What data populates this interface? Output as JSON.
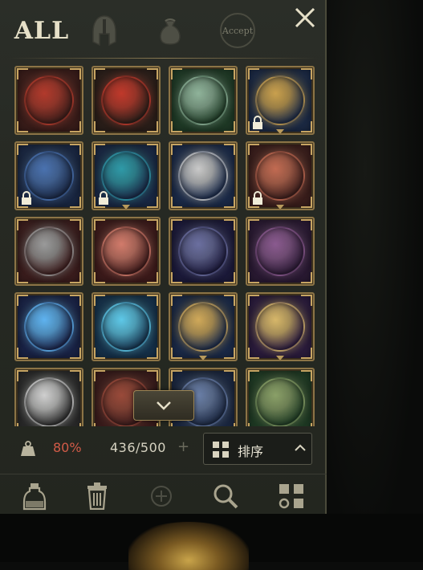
{
  "header": {
    "tab_all_label": "ALL",
    "tab_accept_label": "Accept",
    "close_glyph": "✕"
  },
  "grid": {
    "rows": [
      [
        {
          "name": "red-tome-icon",
          "bg": "#3a1d1a",
          "color": "#b23a2c",
          "locked": false,
          "notch": false
        },
        {
          "name": "lion-crest-shield-icon",
          "bg": "#2b1f1a",
          "color": "#c0392b",
          "locked": false,
          "notch": false
        },
        {
          "name": "green-mask-shield-icon",
          "bg": "#1f3a26",
          "color": "#8fb39a",
          "locked": false,
          "notch": false
        },
        {
          "name": "gold-ornate-crest-icon",
          "bg": "#1c2a45",
          "color": "#c9a04e",
          "locked": true,
          "notch": true
        }
      ],
      [
        {
          "name": "blue-winged-helm-icon",
          "bg": "#1a2742",
          "color": "#4a72b0",
          "locked": true,
          "notch": false
        },
        {
          "name": "teal-orb-crest-icon",
          "bg": "#1a2844",
          "color": "#2f9aa8",
          "locked": true,
          "notch": true
        },
        {
          "name": "yin-yang-icon",
          "bg": "#1b2a48",
          "color": "#c9c9c9",
          "locked": false,
          "notch": false
        },
        {
          "name": "crimson-horned-crest-icon",
          "bg": "#3a1e1c",
          "color": "#c26b52",
          "locked": true,
          "notch": true
        }
      ],
      [
        {
          "name": "silver-dragon-wreath-icon",
          "bg": "#3b1d1d",
          "color": "#9a9a9a",
          "locked": false,
          "notch": false
        },
        {
          "name": "red-ghost-figure-icon",
          "bg": "#3d1b1b",
          "color": "#d27b6b",
          "locked": false,
          "notch": false
        },
        {
          "name": "dark-crystal-orb-icon",
          "bg": "#1c1a3a",
          "color": "#6b6fa0",
          "locked": false,
          "notch": false
        },
        {
          "name": "purple-beast-skull-icon",
          "bg": "#2a1a33",
          "color": "#8a5a8f",
          "locked": false,
          "notch": false
        }
      ],
      [
        {
          "name": "blue-star-crystal-icon",
          "bg": "#1a2346",
          "color": "#5fb3f0",
          "locked": false,
          "notch": false
        },
        {
          "name": "blue-diamond-gem-icon",
          "bg": "#16314a",
          "color": "#5ec8e8",
          "locked": false,
          "notch": false
        },
        {
          "name": "pocket-watch-icon",
          "bg": "#1b2a48",
          "color": "#d0a95a",
          "locked": false,
          "notch": true
        },
        {
          "name": "gold-filigree-crest-icon",
          "bg": "#2b1c3d",
          "color": "#d7b76a",
          "locked": false,
          "notch": true
        }
      ],
      [
        {
          "name": "silver-blade-icon",
          "bg": "#2a2a2a",
          "color": "#cfcfcf",
          "locked": false,
          "notch": false
        },
        {
          "name": "red-bow-icon",
          "bg": "#3a1c1c",
          "color": "#9a4a3a",
          "locked": false,
          "notch": false
        },
        {
          "name": "blue-bow-icon",
          "bg": "#1b2740",
          "color": "#6a7fa8",
          "locked": false,
          "notch": false
        },
        {
          "name": "green-bow-icon",
          "bg": "#1f3a24",
          "color": "#8aa068",
          "locked": false,
          "notch": false
        }
      ]
    ]
  },
  "status": {
    "weight_percent": "80%",
    "capacity": "436/500",
    "plus_glyph": "+",
    "sort_label": "排序"
  },
  "colors": {
    "gold_frame": "#8c7446",
    "warning_red": "#d25b48",
    "cream_text": "#e6e0c8"
  }
}
